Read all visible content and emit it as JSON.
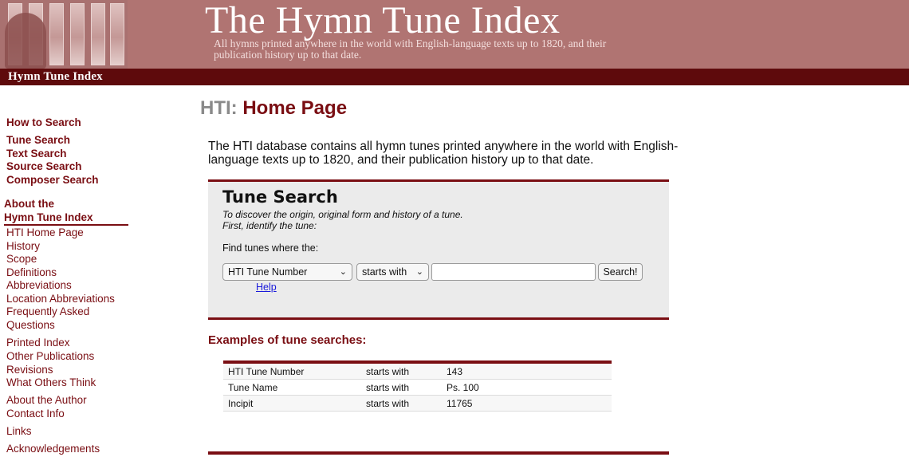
{
  "banner": {
    "title": "The Hymn Tune Index",
    "subtitle": "All hymns printed anywhere in the world with English-language texts up to 1820, and their publication history up to that date.",
    "site_name": "Hymn Tune Index"
  },
  "sidebar": {
    "search_links": [
      {
        "label": "How to Search"
      },
      {
        "label": "Tune Search"
      },
      {
        "label": "Text Search"
      },
      {
        "label": "Source Search"
      },
      {
        "label": "Composer Search"
      }
    ],
    "about_heading_line1": "About the",
    "about_heading_line2": "Hymn Tune Index",
    "about_links": [
      {
        "label": "HTI Home Page"
      },
      {
        "label": "History"
      },
      {
        "label": "Scope"
      },
      {
        "label": "Definitions"
      },
      {
        "label": "Abbreviations"
      },
      {
        "label": "Location Abbreviations"
      },
      {
        "label": "Frequently Asked"
      },
      {
        "label": "Questions"
      }
    ],
    "more_links": [
      {
        "label": "Printed Index"
      },
      {
        "label": "Other Publications"
      },
      {
        "label": "Revisions"
      },
      {
        "label": "What Others Think"
      },
      {
        "label": "About the Author"
      },
      {
        "label": "Contact Info"
      },
      {
        "label": "Links"
      },
      {
        "label": "Acknowledgements"
      }
    ]
  },
  "main": {
    "title_prefix": "HTI:",
    "title": "Home Page",
    "intro": "The HTI database contains all hymn tunes printed anywhere in the world with English-language texts up to 1820, and their publication history up to that date.",
    "search": {
      "heading": "Tune Search",
      "desc_line1": "To discover the origin, original form and history of a tune.",
      "desc_line2": "First, identify the tune:",
      "find_label": "Find tunes where the:",
      "field_select": "HTI Tune Number",
      "operator_select": "starts with",
      "query_value": "",
      "button": "Search!",
      "help": "Help"
    },
    "examples_heading": "Examples of tune searches:",
    "examples": [
      {
        "field": "HTI Tune Number",
        "op": "starts with",
        "value": "143"
      },
      {
        "field": "Tune Name",
        "op": "starts with",
        "value": "Ps. 100"
      },
      {
        "field": "Incipit",
        "op": "starts with",
        "value": "11765"
      }
    ]
  },
  "colors": {
    "accent": "#7a0e13",
    "banner": "#b07472",
    "banner_strip": "#5e0a0c",
    "link_blue": "#1a1adb"
  },
  "icons": {
    "dropdown": "chevron-down-icon"
  }
}
